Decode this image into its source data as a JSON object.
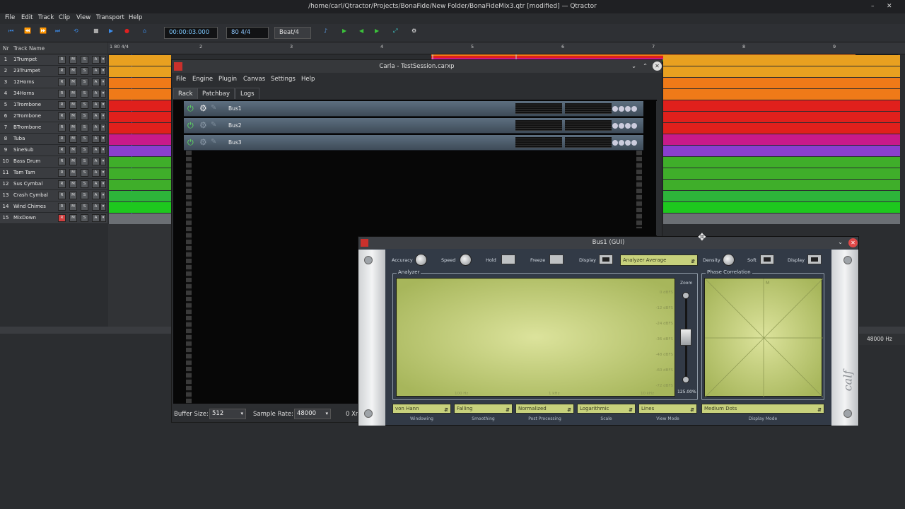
{
  "window": {
    "title": "/home/carl/Qtractor/Projects/BonaFide/New Folder/BonaFideMix3.qtr [modified] — Qtractor"
  },
  "menu": [
    "File",
    "Edit",
    "Track",
    "Clip",
    "View",
    "Transport",
    "Help"
  ],
  "toolbar": {
    "time": "00:00:03.000",
    "tempo": "80 4/4",
    "snap": "Beat/4"
  },
  "tracklist": {
    "header_nr": "Nr",
    "header_name": "Track Name",
    "button_labels": [
      "R",
      "M",
      "S",
      "A"
    ],
    "tracks": [
      {
        "num": "1",
        "name": "1Trumpet",
        "color": "#e8a020"
      },
      {
        "num": "2",
        "name": "23Trumpet",
        "color": "#e8a020"
      },
      {
        "num": "3",
        "name": "12Horns",
        "color": "#ef7a18"
      },
      {
        "num": "4",
        "name": "34Horns",
        "color": "#ef7a18"
      },
      {
        "num": "5",
        "name": "1Trombone",
        "color": "#e0201c"
      },
      {
        "num": "6",
        "name": "2Trombone",
        "color": "#e0201c"
      },
      {
        "num": "7",
        "name": "BTrombone",
        "color": "#e0201c"
      },
      {
        "num": "8",
        "name": "Tuba",
        "color": "#c81a8a"
      },
      {
        "num": "9",
        "name": "SineSub",
        "color": "#8a3ed0"
      },
      {
        "num": "10",
        "name": "Bass Drum",
        "color": "#3fae2a"
      },
      {
        "num": "11",
        "name": "Tam Tam",
        "color": "#3fae2a"
      },
      {
        "num": "12",
        "name": "Sus Cymbal",
        "color": "#3fae2a"
      },
      {
        "num": "13",
        "name": "Crash Cymbal",
        "color": "#2db43a"
      },
      {
        "num": "14",
        "name": "Wind Chimes",
        "color": "#1ec81e"
      },
      {
        "num": "15",
        "name": "MixDown",
        "color": "#6b6f74"
      }
    ]
  },
  "ruler": {
    "marks": [
      "1 80 4/4",
      "2",
      "3",
      "4",
      "5",
      "6",
      "7",
      "8",
      "9"
    ]
  },
  "status": {
    "sample_rate": "48000 Hz"
  },
  "carla": {
    "title": "Carla - TestSession.carxp",
    "menu": [
      "File",
      "Engine",
      "Plugin",
      "Canvas",
      "Settings",
      "Help"
    ],
    "tabs": [
      "Rack",
      "Patchbay",
      "Logs"
    ],
    "plugins": [
      "Bus1",
      "Bus2",
      "Bus3"
    ],
    "buffer_label": "Buffer Size:",
    "buffer_value": "512",
    "rate_label": "Sample Rate:",
    "rate_value": "48000",
    "xruns": "0 Xr"
  },
  "calf": {
    "title": "Bus1 (GUI)",
    "controls": {
      "accuracy": "Accuracy",
      "speed": "Speed",
      "hold": "Hold",
      "freeze": "Freeze",
      "display": "Display",
      "density": "Density",
      "soft": "Soft",
      "display2": "Display"
    },
    "mode_value": "Analyzer Average",
    "analyzer_label": "Analyzer",
    "phase_label": "Phase Correlation",
    "zoom_label": "Zoom",
    "zoom_value": "125.00%",
    "db_labels": [
      "0 dBFS",
      "-12 dBFS",
      "-24 dBFS",
      "-36 dBFS",
      "-48 dBFS",
      "-60 dBFS",
      "-72 dBFS"
    ],
    "freq_labels": [
      "100 Hz",
      "1 kHz",
      "10 kHz"
    ],
    "phase_mark": "M",
    "combos": [
      {
        "value": "von Hann",
        "label": "Windowing"
      },
      {
        "value": "Falling",
        "label": "Smoothing"
      },
      {
        "value": "Normalized",
        "label": "Post Processing"
      },
      {
        "value": "Logarithmic",
        "label": "Scale"
      },
      {
        "value": "Lines",
        "label": "View Mode"
      },
      {
        "value": "Medium Dots",
        "label": "Display Mode"
      }
    ],
    "logo": "calf"
  }
}
